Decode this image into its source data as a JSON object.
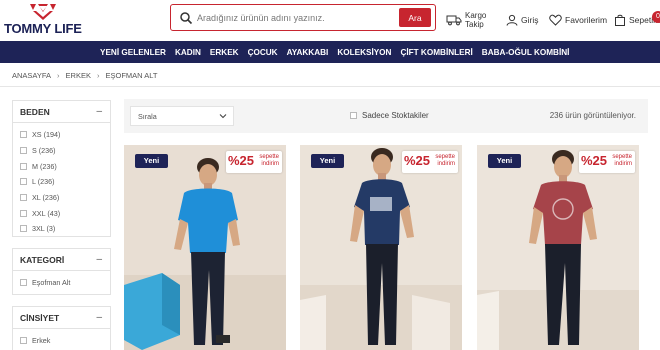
{
  "header": {
    "brand": "TOMMY LIFE",
    "search_placeholder": "Aradığınız ürünün adını yazınız.",
    "search_button": "Ara",
    "cargo_line1": "Kargo",
    "cargo_line2": "Takip",
    "login": "Giriş",
    "favorites": "Favorilerim",
    "cart": "Sepetim",
    "cart_count": "0"
  },
  "nav": {
    "items": [
      "YENİ GELENLER",
      "KADIN",
      "ERKEK",
      "ÇOCUK",
      "AYAKKABI",
      "KOLEKSİYON",
      "ÇİFT KOMBİNLERİ",
      "BABA-OĞUL KOMBİNİ"
    ]
  },
  "breadcrumb": {
    "items": [
      "ANASAYFA",
      "ERKEK",
      "EŞOFMAN ALT"
    ],
    "separator": "›"
  },
  "filters": {
    "size": {
      "title": "BEDEN",
      "toggle": "–",
      "options": [
        "XS (194)",
        "S (236)",
        "M (236)",
        "L (236)",
        "XL (236)",
        "XXL (43)",
        "3XL (3)"
      ]
    },
    "category": {
      "title": "KATEGORİ",
      "toggle": "–",
      "options": [
        "Eşofman Alt"
      ]
    },
    "gender": {
      "title": "CİNSİYET",
      "toggle": "–",
      "options": [
        "Erkek"
      ]
    }
  },
  "toolbar": {
    "sort_label": "Sırala",
    "stock_label": "Sadece Stoktakiler",
    "count_text": "236 ürün görüntüleniyor."
  },
  "products": [
    {
      "badge": "Yeni",
      "promo_pct": "%25",
      "promo_line1": "sepette",
      "promo_line2": "indirim",
      "shirt_color": "#1f8fd8"
    },
    {
      "badge": "Yeni",
      "promo_pct": "%25",
      "promo_line1": "sepette",
      "promo_line2": "indirim",
      "shirt_color": "#243a66"
    },
    {
      "badge": "Yeni",
      "promo_pct": "%25",
      "promo_line1": "sepette",
      "promo_line2": "indirim",
      "shirt_color": "#a6444a"
    }
  ],
  "colors": {
    "brand_navy": "#1e2357",
    "accent_red": "#c7252f"
  }
}
